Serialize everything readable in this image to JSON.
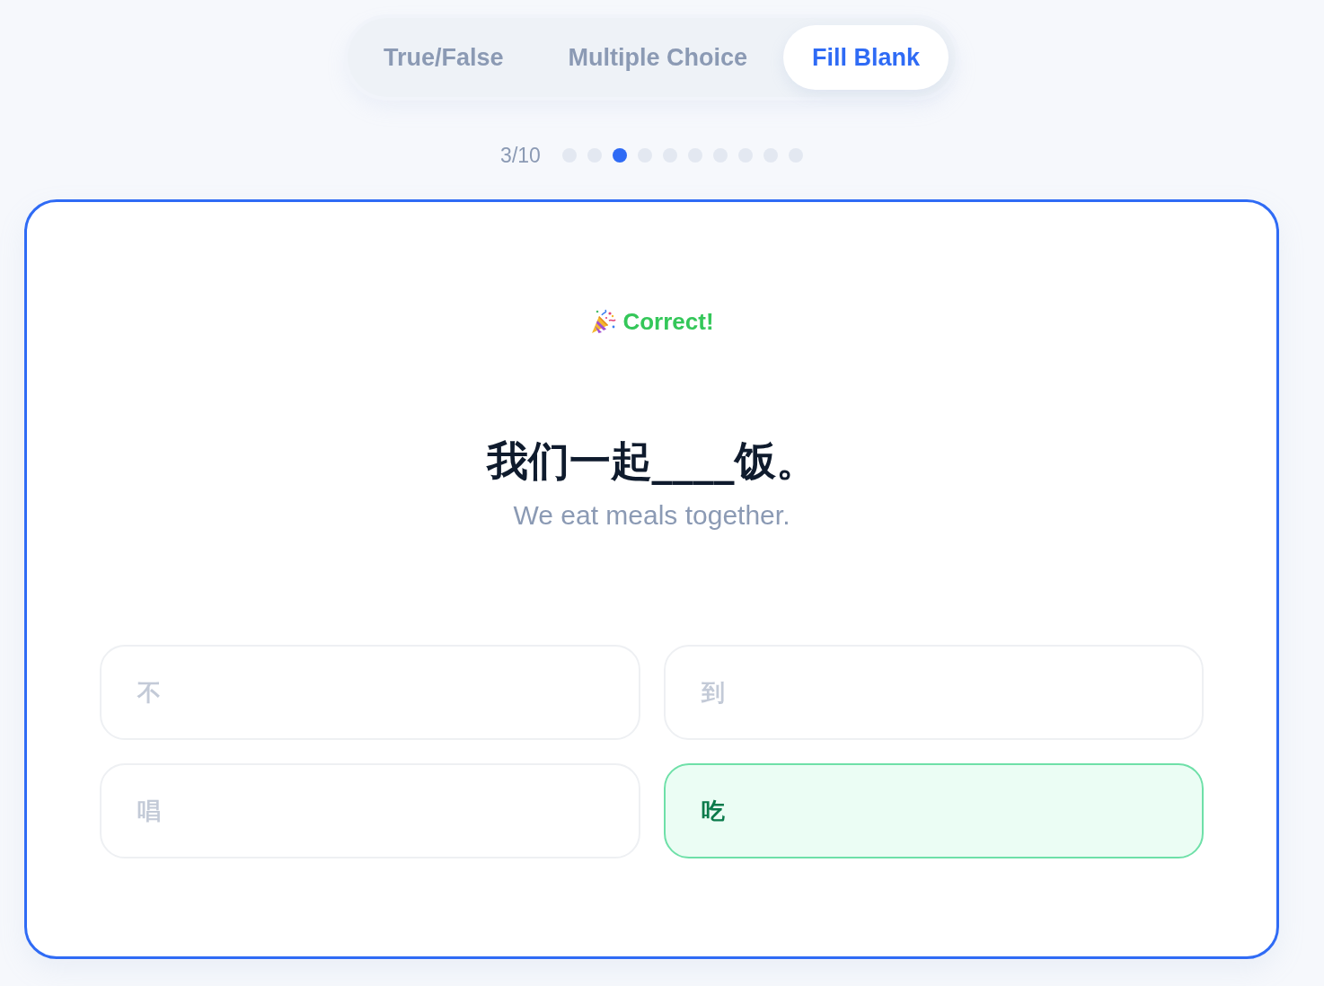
{
  "tabs": [
    {
      "label": "True/False",
      "selected": false
    },
    {
      "label": "Multiple Choice",
      "selected": false
    },
    {
      "label": "Fill Blank",
      "selected": true
    }
  ],
  "progress": {
    "counter": "3/10",
    "dots": [
      {
        "current": false
      },
      {
        "current": false
      },
      {
        "current": true
      },
      {
        "current": false
      },
      {
        "current": false
      },
      {
        "current": false
      },
      {
        "current": false
      },
      {
        "current": false
      },
      {
        "current": false
      },
      {
        "current": false
      }
    ]
  },
  "card": {
    "feedback": {
      "kind": "correct",
      "text": "Correct!"
    },
    "sentence": "我们一起____饭。",
    "translation": "We eat meals together.",
    "options": [
      {
        "label": "不",
        "correct": false
      },
      {
        "label": "到",
        "correct": false
      },
      {
        "label": "唱",
        "correct": false
      },
      {
        "label": "吃",
        "correct": true
      }
    ]
  }
}
